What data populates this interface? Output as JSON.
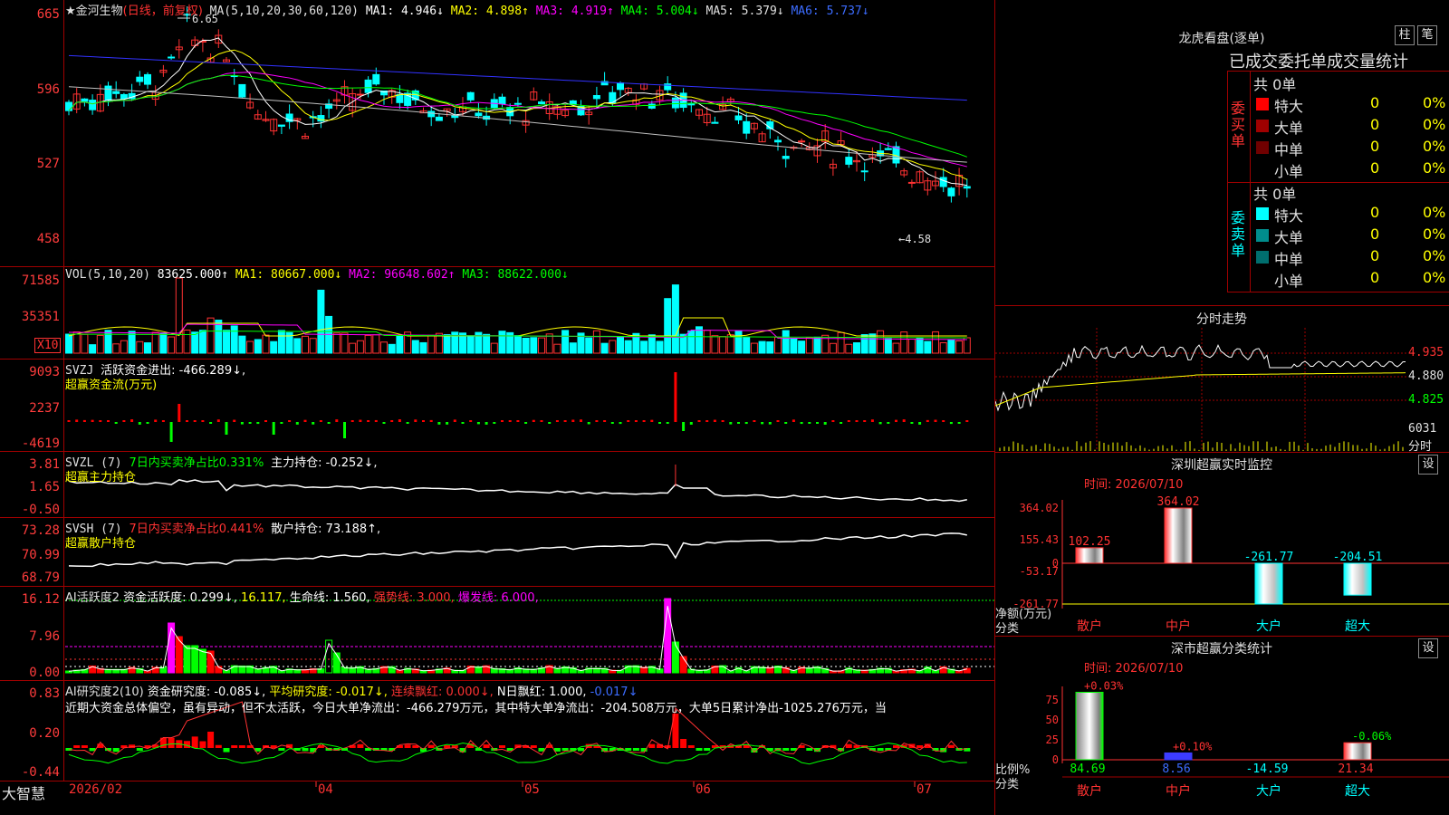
{
  "stock": {
    "name_label": "★金河生物",
    "period_label": "(日线，前复权)",
    "ma_header": "MA(5,10,20,30,60,120)",
    "ma1": "MA1: 4.946↓",
    "ma2": "MA2: 4.898↑",
    "ma3": "MA3: 4.919↑",
    "ma4": "MA4: 5.004↓",
    "ma5": "MA5: 5.379↓",
    "ma6": "MA6: 5.737↓",
    "high_mark": "6.65",
    "low_mark": "←4.58",
    "colors": {
      "up": "#ff3232",
      "down": "#00ffff",
      "ma1": "#ffffff",
      "ma2": "#ffff00",
      "ma3": "#ff00ff",
      "ma4": "#00ff00",
      "ma5": "#c0c0c0",
      "ma6": "#3232ff"
    }
  },
  "price_axis": [
    "665",
    "596",
    "527",
    "458"
  ],
  "vol_panel": {
    "header": "VOL(5,10,20)",
    "value": "83625.000↑",
    "ma1": "MA1: 80667.000↓",
    "ma2": "MA2: 96648.602↑",
    "ma3": "MA3: 88622.000↓",
    "axis": [
      "71585",
      "35351"
    ],
    "unit": "X10"
  },
  "svzj_panel": {
    "header": "SVZJ",
    "text": "活跃资金进出: -466.289↓,",
    "subtitle": "超赢资金流(万元)",
    "axis": [
      "9093",
      "2237",
      "-4619"
    ]
  },
  "svzl_panel": {
    "header": "SVZL (7)",
    "text1": "7日内买卖净占比0.331%",
    "text2": "主力持仓: -0.252↓,",
    "subtitle": "超赢主力持仓",
    "axis": [
      "3.81",
      "1.65",
      "-0.50"
    ]
  },
  "svsh_panel": {
    "header": "SVSH (7)",
    "text1": "7日内买卖净占比0.441%",
    "text2": "散户持仓: 73.188↑,",
    "subtitle": "超赢散户持仓",
    "axis": [
      "73.28",
      "70.99",
      "68.79"
    ]
  },
  "ai_active_panel": {
    "header": "AI活跃度2",
    "text1": "资金活跃度: 0.299↓,",
    "text2": "16.117,",
    "text3": "生命线: 1.560,",
    "text4": "强势线: 3.000,",
    "text5": "爆发线: 6.000,",
    "axis": [
      "16.12",
      "7.96",
      "0.00"
    ]
  },
  "ai_research_panel": {
    "header": "AI研究度2(10)",
    "text1": "资金研究度: -0.085↓,",
    "text2": "平均研究度: -0.017↓,",
    "text3": "连续飘红: 0.000↓,",
    "text4": "N日飘红: 1.000,",
    "text5": "-0.017↓",
    "comment": "近期大资金总体偏空，虽有异动，但不太活跃，今日大单净流出：-466.279万元，其中特大单净流出：-204.508万元，大单5日累计净出-1025.276万元，当",
    "axis": [
      "0.83",
      "0.20",
      "-0.44"
    ]
  },
  "date_axis": {
    "brand": "大智慧",
    "labels": [
      "2026/02",
      "04",
      "05",
      "06",
      "07"
    ]
  },
  "dragon_tiger": {
    "title": "龙虎看盘(逐单)",
    "btn_zhu": "柱",
    "btn_bi": "笔",
    "subtitle": "已成交委托单成交量统计",
    "buy_label": "委买单",
    "sell_label": "委卖单",
    "buy_total": "共 0单",
    "sell_total": "共 0单",
    "buy_rows": [
      {
        "label": "特大",
        "count": "0",
        "pct": "0%",
        "color": "#ff0000"
      },
      {
        "label": "大单",
        "count": "0",
        "pct": "0%",
        "color": "#a00000"
      },
      {
        "label": "中单",
        "count": "0",
        "pct": "0%",
        "color": "#700000"
      },
      {
        "label": "小单",
        "count": "0",
        "pct": "0%",
        "color": "#000000"
      }
    ],
    "sell_rows": [
      {
        "label": "特大",
        "count": "0",
        "pct": "0%",
        "color": "#00ffff"
      },
      {
        "label": "大单",
        "count": "0",
        "pct": "0%",
        "color": "#008c8c"
      },
      {
        "label": "中单",
        "count": "0",
        "pct": "0%",
        "color": "#006e6e"
      },
      {
        "label": "小单",
        "count": "0",
        "pct": "0%",
        "color": "#000000"
      }
    ]
  },
  "intraday": {
    "title": "分时走势",
    "price_ticks": [
      "4.935",
      "4.880",
      "4.825"
    ],
    "vol_tick": "6031",
    "vol_label": "分时"
  },
  "sz_monitor": {
    "title": "深圳超赢实时监控",
    "settings": "设",
    "time": "时间: 2026/07/10",
    "axis": [
      "364.02",
      "155.43",
      "0",
      "-53.17",
      "-261.77"
    ],
    "y_label": "净额(万元)",
    "x_label": "分类",
    "categories": [
      "散户",
      "中户",
      "大户",
      "超大"
    ],
    "values": [
      "102.25",
      "364.02",
      "-261.77",
      "-204.51"
    ]
  },
  "sz_class": {
    "title": "深市超赢分类统计",
    "settings": "设",
    "time": "时间: 2026/07/10",
    "axis": [
      "75",
      "50",
      "25",
      "0"
    ],
    "y_label": "比例%",
    "x_label": "分类",
    "categories": [
      "散户",
      "中户",
      "大户",
      "超大"
    ],
    "values": [
      "84.69",
      "8.56",
      "-14.59",
      "21.34"
    ],
    "changes": [
      "+0.03%",
      "+0.10%",
      "",
      "-0.06%"
    ]
  }
}
